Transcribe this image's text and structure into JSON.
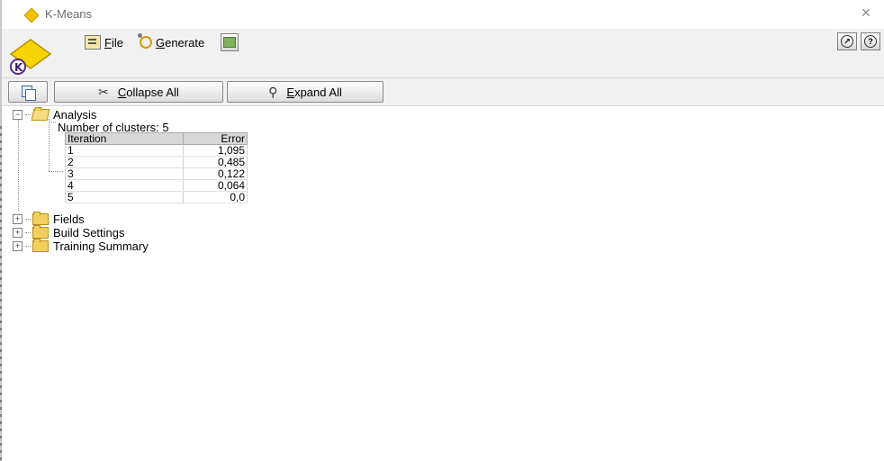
{
  "window": {
    "title": "K-Means",
    "close_label": "×"
  },
  "menu": {
    "file_accel": "F",
    "file_rest": "ile",
    "generate_accel": "G",
    "generate_rest": "enerate"
  },
  "toolbar": {
    "collapse_accel": "C",
    "collapse_rest": "ollapse All",
    "expand_accel": "E",
    "expand_rest": "xpand All"
  },
  "tree": {
    "analysis": {
      "label": "Analysis",
      "clusters_text": "Number of clusters: 5",
      "table": {
        "headers": [
          "Iteration",
          "Error"
        ],
        "rows": [
          [
            "1",
            "1,095"
          ],
          [
            "2",
            "0,485"
          ],
          [
            "3",
            "0,122"
          ],
          [
            "4",
            "0,064"
          ],
          [
            "5",
            "0,0"
          ]
        ]
      }
    },
    "fields_label": "Fields",
    "build_settings_label": "Build Settings",
    "training_summary_label": "Training Summary"
  },
  "colors": {
    "accent_folder": "#f2cf5a",
    "toolbar_bg": "#f1f1f1",
    "logo_yellow": "#f2c200"
  },
  "icons": [
    "diamond-icon",
    "close-icon",
    "kmeans-logo-icon",
    "file-menu-icon",
    "generate-icon",
    "preview-icon",
    "navigate-icon",
    "help-icon",
    "copy-icon",
    "collapse-icon",
    "expand-icon",
    "folder-icon"
  ]
}
